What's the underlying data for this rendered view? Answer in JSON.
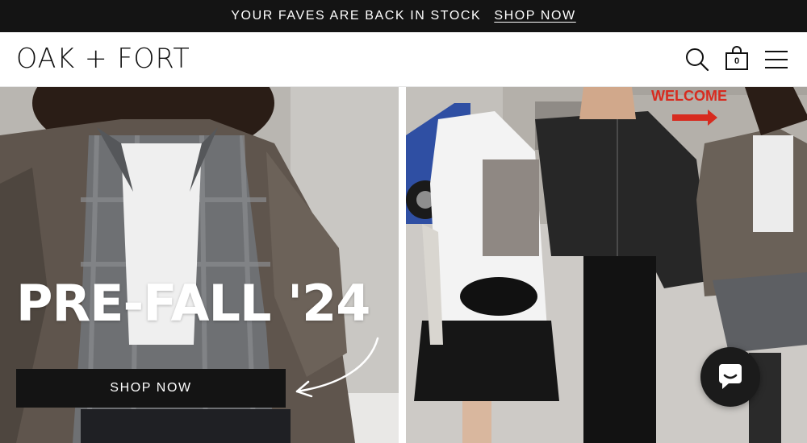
{
  "announcement": {
    "message": "YOUR FAVES ARE BACK IN STOCK",
    "link_label": "SHOP NOW"
  },
  "header": {
    "logo": "OAK + FORT",
    "bag_count": "0",
    "icons": [
      "search-icon",
      "shopping-bag-icon",
      "hamburger-menu-icon"
    ]
  },
  "hero": {
    "title": "PRE-FALL '24",
    "button_label": "SHOP NOW",
    "photo_sign_text": "WELCOME"
  },
  "chat": {
    "icon": "chat-bubble-icon"
  },
  "colors": {
    "bar": "#141414",
    "text_light": "#ffffff",
    "text_dark": "#111111",
    "sign_red": "#d72b1f"
  }
}
